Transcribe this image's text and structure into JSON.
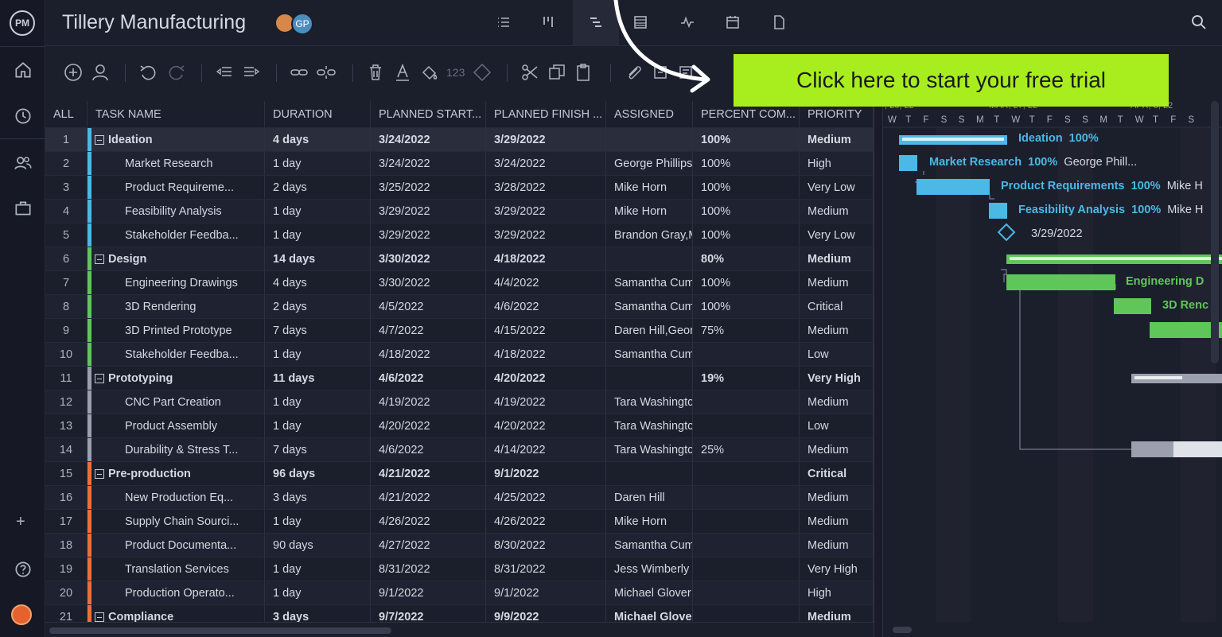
{
  "app": {
    "logo": "PM",
    "project_title": "Tillery Manufacturing",
    "avatar_initials": "GP"
  },
  "cta": {
    "label": "Click here to start your free trial",
    "color": "#a8ee1e"
  },
  "view_icons": [
    "list-view-icon",
    "board-view-icon",
    "gantt-view-icon",
    "sheet-view-icon",
    "dashboard-view-icon",
    "calendar-view-icon",
    "docs-view-icon"
  ],
  "toolbar": {
    "numeric_label": "123"
  },
  "grid": {
    "columns": [
      "ALL",
      "TASK NAME",
      "DURATION",
      "PLANNED START...",
      "PLANNED FINISH ...",
      "ASSIGNED",
      "PERCENT COM...",
      "PRIORITY"
    ],
    "rows": [
      {
        "n": "1",
        "name": "Ideation",
        "dur": "4 days",
        "start": "3/24/2022",
        "finish": "3/29/2022",
        "assigned": "",
        "pct": "100%",
        "priority": "Medium",
        "group": true,
        "color": "#4bb8e6"
      },
      {
        "n": "2",
        "name": "Market Research",
        "dur": "1 day",
        "start": "3/24/2022",
        "finish": "3/24/2022",
        "assigned": "George Phillips",
        "pct": "100%",
        "priority": "High",
        "group": false,
        "color": "#4bb8e6"
      },
      {
        "n": "3",
        "name": "Product Requireme...",
        "dur": "2 days",
        "start": "3/25/2022",
        "finish": "3/28/2022",
        "assigned": "Mike Horn",
        "pct": "100%",
        "priority": "Very Low",
        "group": false,
        "color": "#4bb8e6"
      },
      {
        "n": "4",
        "name": "Feasibility Analysis",
        "dur": "1 day",
        "start": "3/29/2022",
        "finish": "3/29/2022",
        "assigned": "Mike Horn",
        "pct": "100%",
        "priority": "Medium",
        "group": false,
        "color": "#4bb8e6"
      },
      {
        "n": "5",
        "name": "Stakeholder Feedba...",
        "dur": "1 day",
        "start": "3/29/2022",
        "finish": "3/29/2022",
        "assigned": "Brandon Gray,M",
        "pct": "100%",
        "priority": "Very Low",
        "group": false,
        "color": "#4bb8e6"
      },
      {
        "n": "6",
        "name": "Design",
        "dur": "14 days",
        "start": "3/30/2022",
        "finish": "4/18/2022",
        "assigned": "",
        "pct": "80%",
        "priority": "Medium",
        "group": true,
        "color": "#5fc65a"
      },
      {
        "n": "7",
        "name": "Engineering Drawings",
        "dur": "4 days",
        "start": "3/30/2022",
        "finish": "4/4/2022",
        "assigned": "Samantha Cum",
        "pct": "100%",
        "priority": "Medium",
        "group": false,
        "color": "#5fc65a"
      },
      {
        "n": "8",
        "name": "3D Rendering",
        "dur": "2 days",
        "start": "4/5/2022",
        "finish": "4/6/2022",
        "assigned": "Samantha Cum",
        "pct": "100%",
        "priority": "Critical",
        "group": false,
        "color": "#5fc65a"
      },
      {
        "n": "9",
        "name": "3D Printed Prototype",
        "dur": "7 days",
        "start": "4/7/2022",
        "finish": "4/15/2022",
        "assigned": "Daren Hill,Geor",
        "pct": "75%",
        "priority": "Medium",
        "group": false,
        "color": "#5fc65a"
      },
      {
        "n": "10",
        "name": "Stakeholder Feedba...",
        "dur": "1 day",
        "start": "4/18/2022",
        "finish": "4/18/2022",
        "assigned": "Samantha Cum",
        "pct": "",
        "priority": "Low",
        "group": false,
        "color": "#5fc65a"
      },
      {
        "n": "11",
        "name": "Prototyping",
        "dur": "11 days",
        "start": "4/6/2022",
        "finish": "4/20/2022",
        "assigned": "",
        "pct": "19%",
        "priority": "Very High",
        "group": true,
        "color": "#9aa0ad"
      },
      {
        "n": "12",
        "name": "CNC Part Creation",
        "dur": "1 day",
        "start": "4/19/2022",
        "finish": "4/19/2022",
        "assigned": "Tara Washingtc",
        "pct": "",
        "priority": "Medium",
        "group": false,
        "color": "#9aa0ad"
      },
      {
        "n": "13",
        "name": "Product Assembly",
        "dur": "1 day",
        "start": "4/20/2022",
        "finish": "4/20/2022",
        "assigned": "Tara Washingtc",
        "pct": "",
        "priority": "Low",
        "group": false,
        "color": "#9aa0ad"
      },
      {
        "n": "14",
        "name": "Durability & Stress T...",
        "dur": "7 days",
        "start": "4/6/2022",
        "finish": "4/14/2022",
        "assigned": "Tara Washingtc",
        "pct": "25%",
        "priority": "Medium",
        "group": false,
        "color": "#9aa0ad"
      },
      {
        "n": "15",
        "name": "Pre-production",
        "dur": "96 days",
        "start": "4/21/2022",
        "finish": "9/1/2022",
        "assigned": "",
        "pct": "",
        "priority": "Critical",
        "group": true,
        "color": "#e8713a"
      },
      {
        "n": "16",
        "name": "New Production Eq...",
        "dur": "3 days",
        "start": "4/21/2022",
        "finish": "4/25/2022",
        "assigned": "Daren Hill",
        "pct": "",
        "priority": "Medium",
        "group": false,
        "color": "#e8713a"
      },
      {
        "n": "17",
        "name": "Supply Chain Sourci...",
        "dur": "1 day",
        "start": "4/26/2022",
        "finish": "4/26/2022",
        "assigned": "Mike Horn",
        "pct": "",
        "priority": "Medium",
        "group": false,
        "color": "#e8713a"
      },
      {
        "n": "18",
        "name": "Product Documenta...",
        "dur": "90 days",
        "start": "4/27/2022",
        "finish": "8/30/2022",
        "assigned": "Samantha Cum",
        "pct": "",
        "priority": "Medium",
        "group": false,
        "color": "#e8713a"
      },
      {
        "n": "19",
        "name": "Translation Services",
        "dur": "1 day",
        "start": "8/31/2022",
        "finish": "8/31/2022",
        "assigned": "Jess Wimberly",
        "pct": "",
        "priority": "Very High",
        "group": false,
        "color": "#e8713a"
      },
      {
        "n": "20",
        "name": "Production Operato...",
        "dur": "1 day",
        "start": "9/1/2022",
        "finish": "9/1/2022",
        "assigned": "Michael Glover",
        "pct": "",
        "priority": "High",
        "group": false,
        "color": "#e8713a"
      },
      {
        "n": "21",
        "name": "Compliance",
        "dur": "3 days",
        "start": "9/7/2022",
        "finish": "9/9/2022",
        "assigned": "Michael Glover",
        "pct": "",
        "priority": "Medium",
        "group": true,
        "color": "#e8713a"
      }
    ]
  },
  "gantt": {
    "months": [
      ", 20, 22",
      "MAR, 27, 22",
      "APR, 3, 22"
    ],
    "days": [
      "W",
      "T",
      "F",
      "S",
      "S",
      "M",
      "T",
      "W",
      "T",
      "F",
      "S",
      "S",
      "M",
      "T",
      "W",
      "T",
      "F",
      "S"
    ],
    "labels": {
      "ideation": "Ideation",
      "ideation_pct": "100%",
      "market_research": "Market Research",
      "market_research_pct": "100%",
      "market_research_assignee": "George Phill...",
      "product_req": "Product Requirements",
      "product_req_pct": "100%",
      "product_req_assignee": "Mike H",
      "feasibility": "Feasibility Analysis",
      "feasibility_pct": "100%",
      "feasibility_assignee": "Mike H",
      "milestone_date": "3/29/2022",
      "engineering": "Engineering D",
      "rendering": "3D Renc"
    },
    "colors": {
      "blue": "#4bb8e6",
      "green": "#5fc65a",
      "gray": "#9aa0ad"
    }
  }
}
